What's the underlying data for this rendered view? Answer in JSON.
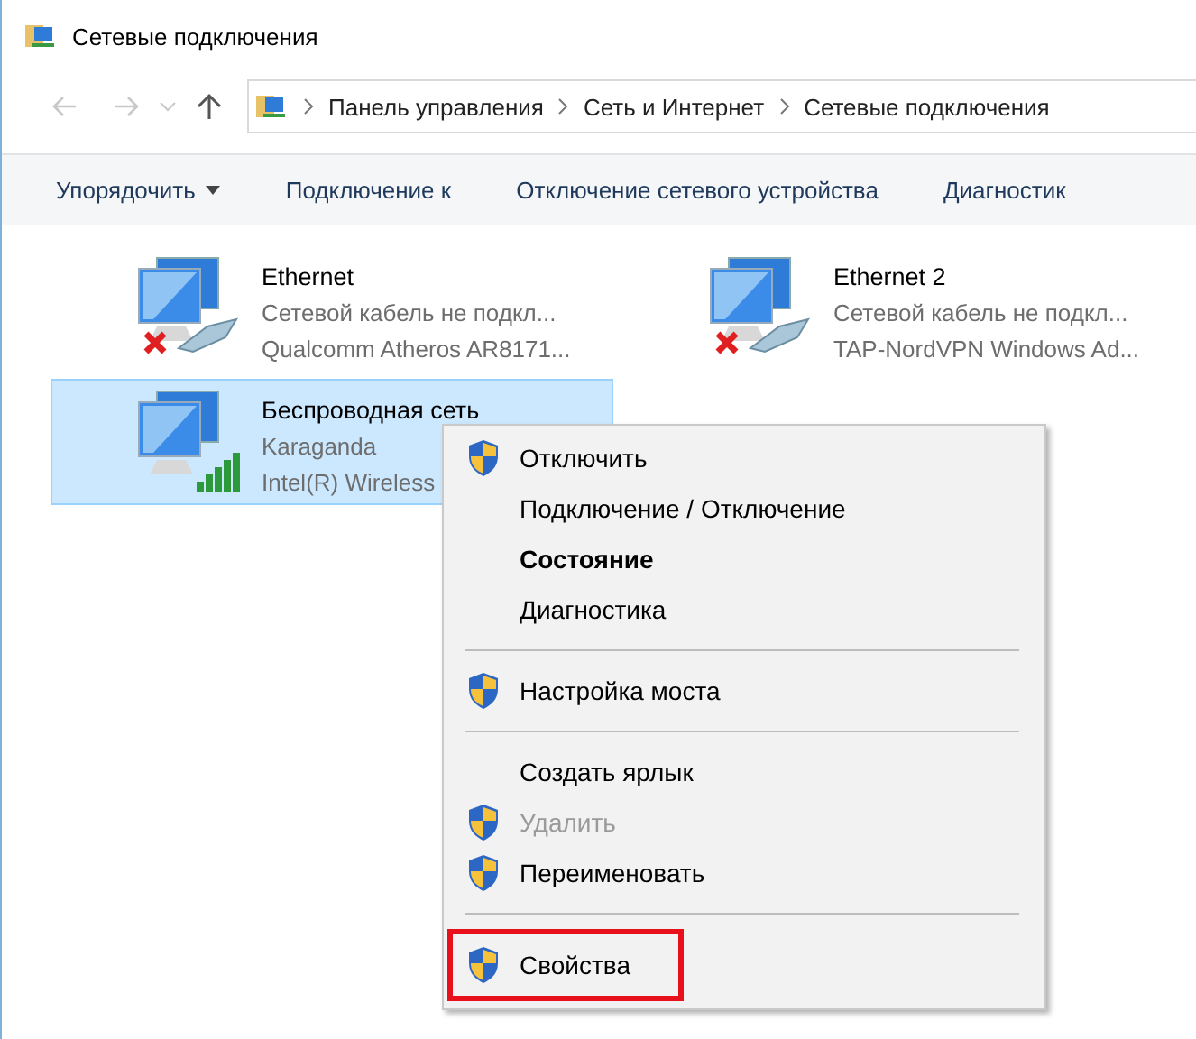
{
  "window": {
    "title": "Сетевые подключения"
  },
  "address": {
    "crumbs": [
      "Панель управления",
      "Сеть и Интернет",
      "Сетевые подключения"
    ]
  },
  "toolbar": [
    {
      "label": "Упорядочить",
      "dropdown": true
    },
    {
      "label": "Подключение к",
      "dropdown": false
    },
    {
      "label": "Отключение сетевого устройства",
      "dropdown": false
    },
    {
      "label": "Диагностик",
      "dropdown": false
    }
  ],
  "adapters": [
    {
      "name": "Ethernet",
      "status": "Сетевой кабель не подкл...",
      "device": "Qualcomm Atheros AR8171...",
      "kind": "wired",
      "selected": false
    },
    {
      "name": "Ethernet 2",
      "status": "Сетевой кабель не подкл...",
      "device": "TAP-NordVPN Windows Ad...",
      "kind": "wired",
      "selected": false
    },
    {
      "name": "Беспроводная сеть",
      "status": "Karaganda",
      "device": "Intel(R) Wireless",
      "kind": "wireless",
      "selected": true
    }
  ],
  "context_menu": [
    {
      "kind": "item",
      "label": "Отключить",
      "shield": true,
      "bold": false,
      "disabled": false,
      "highlighted": false
    },
    {
      "kind": "item",
      "label": "Подключение / Отключение",
      "shield": false,
      "bold": false,
      "disabled": false,
      "highlighted": false
    },
    {
      "kind": "item",
      "label": "Состояние",
      "shield": false,
      "bold": true,
      "disabled": false,
      "highlighted": false
    },
    {
      "kind": "item",
      "label": "Диагностика",
      "shield": false,
      "bold": false,
      "disabled": false,
      "highlighted": false
    },
    {
      "kind": "separator"
    },
    {
      "kind": "item",
      "label": "Настройка моста",
      "shield": true,
      "bold": false,
      "disabled": false,
      "highlighted": false
    },
    {
      "kind": "separator"
    },
    {
      "kind": "item",
      "label": "Создать ярлык",
      "shield": false,
      "bold": false,
      "disabled": false,
      "highlighted": false
    },
    {
      "kind": "item",
      "label": "Удалить",
      "shield": true,
      "bold": false,
      "disabled": true,
      "highlighted": false
    },
    {
      "kind": "item",
      "label": "Переименовать",
      "shield": true,
      "bold": false,
      "disabled": false,
      "highlighted": false
    },
    {
      "kind": "separator"
    },
    {
      "kind": "item",
      "label": "Свойства",
      "shield": true,
      "bold": false,
      "disabled": false,
      "highlighted": true
    }
  ]
}
